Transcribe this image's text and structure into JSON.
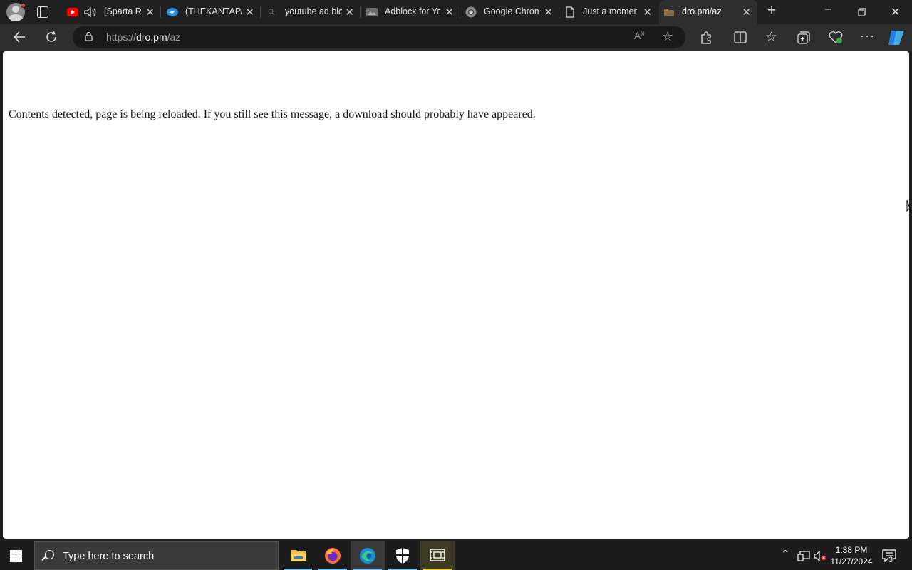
{
  "tabs": [
    {
      "title": "[Sparta Re",
      "favicon": "youtube-icon",
      "audio": true
    },
    {
      "title": "(THEKANTAPA",
      "favicon": "chat-icon"
    },
    {
      "title": "youtube ad blo",
      "favicon": "search-icon"
    },
    {
      "title": "Adblock for Yo",
      "favicon": "image-icon"
    },
    {
      "title": "Google Chrom",
      "favicon": "chrome-icon"
    },
    {
      "title": "Just a moment",
      "favicon": "page-icon"
    },
    {
      "title": "dro.pm/az",
      "favicon": "dropbox-icon",
      "active": true
    }
  ],
  "address_bar": {
    "url_prefix": "https://",
    "url_host": "dro.pm",
    "url_path": "/az"
  },
  "page": {
    "message": "Contents detected, page is being reloaded. If you still see this message, a download should probably have appeared."
  },
  "taskbar": {
    "search_placeholder": "Type here to search",
    "time": "1:38 PM",
    "date": "11/27/2024",
    "notification_count": "3"
  },
  "colors": {
    "accent": "#76b9ed",
    "browser_bg": "#202020",
    "toolbar_bg": "#2e2e2e"
  }
}
